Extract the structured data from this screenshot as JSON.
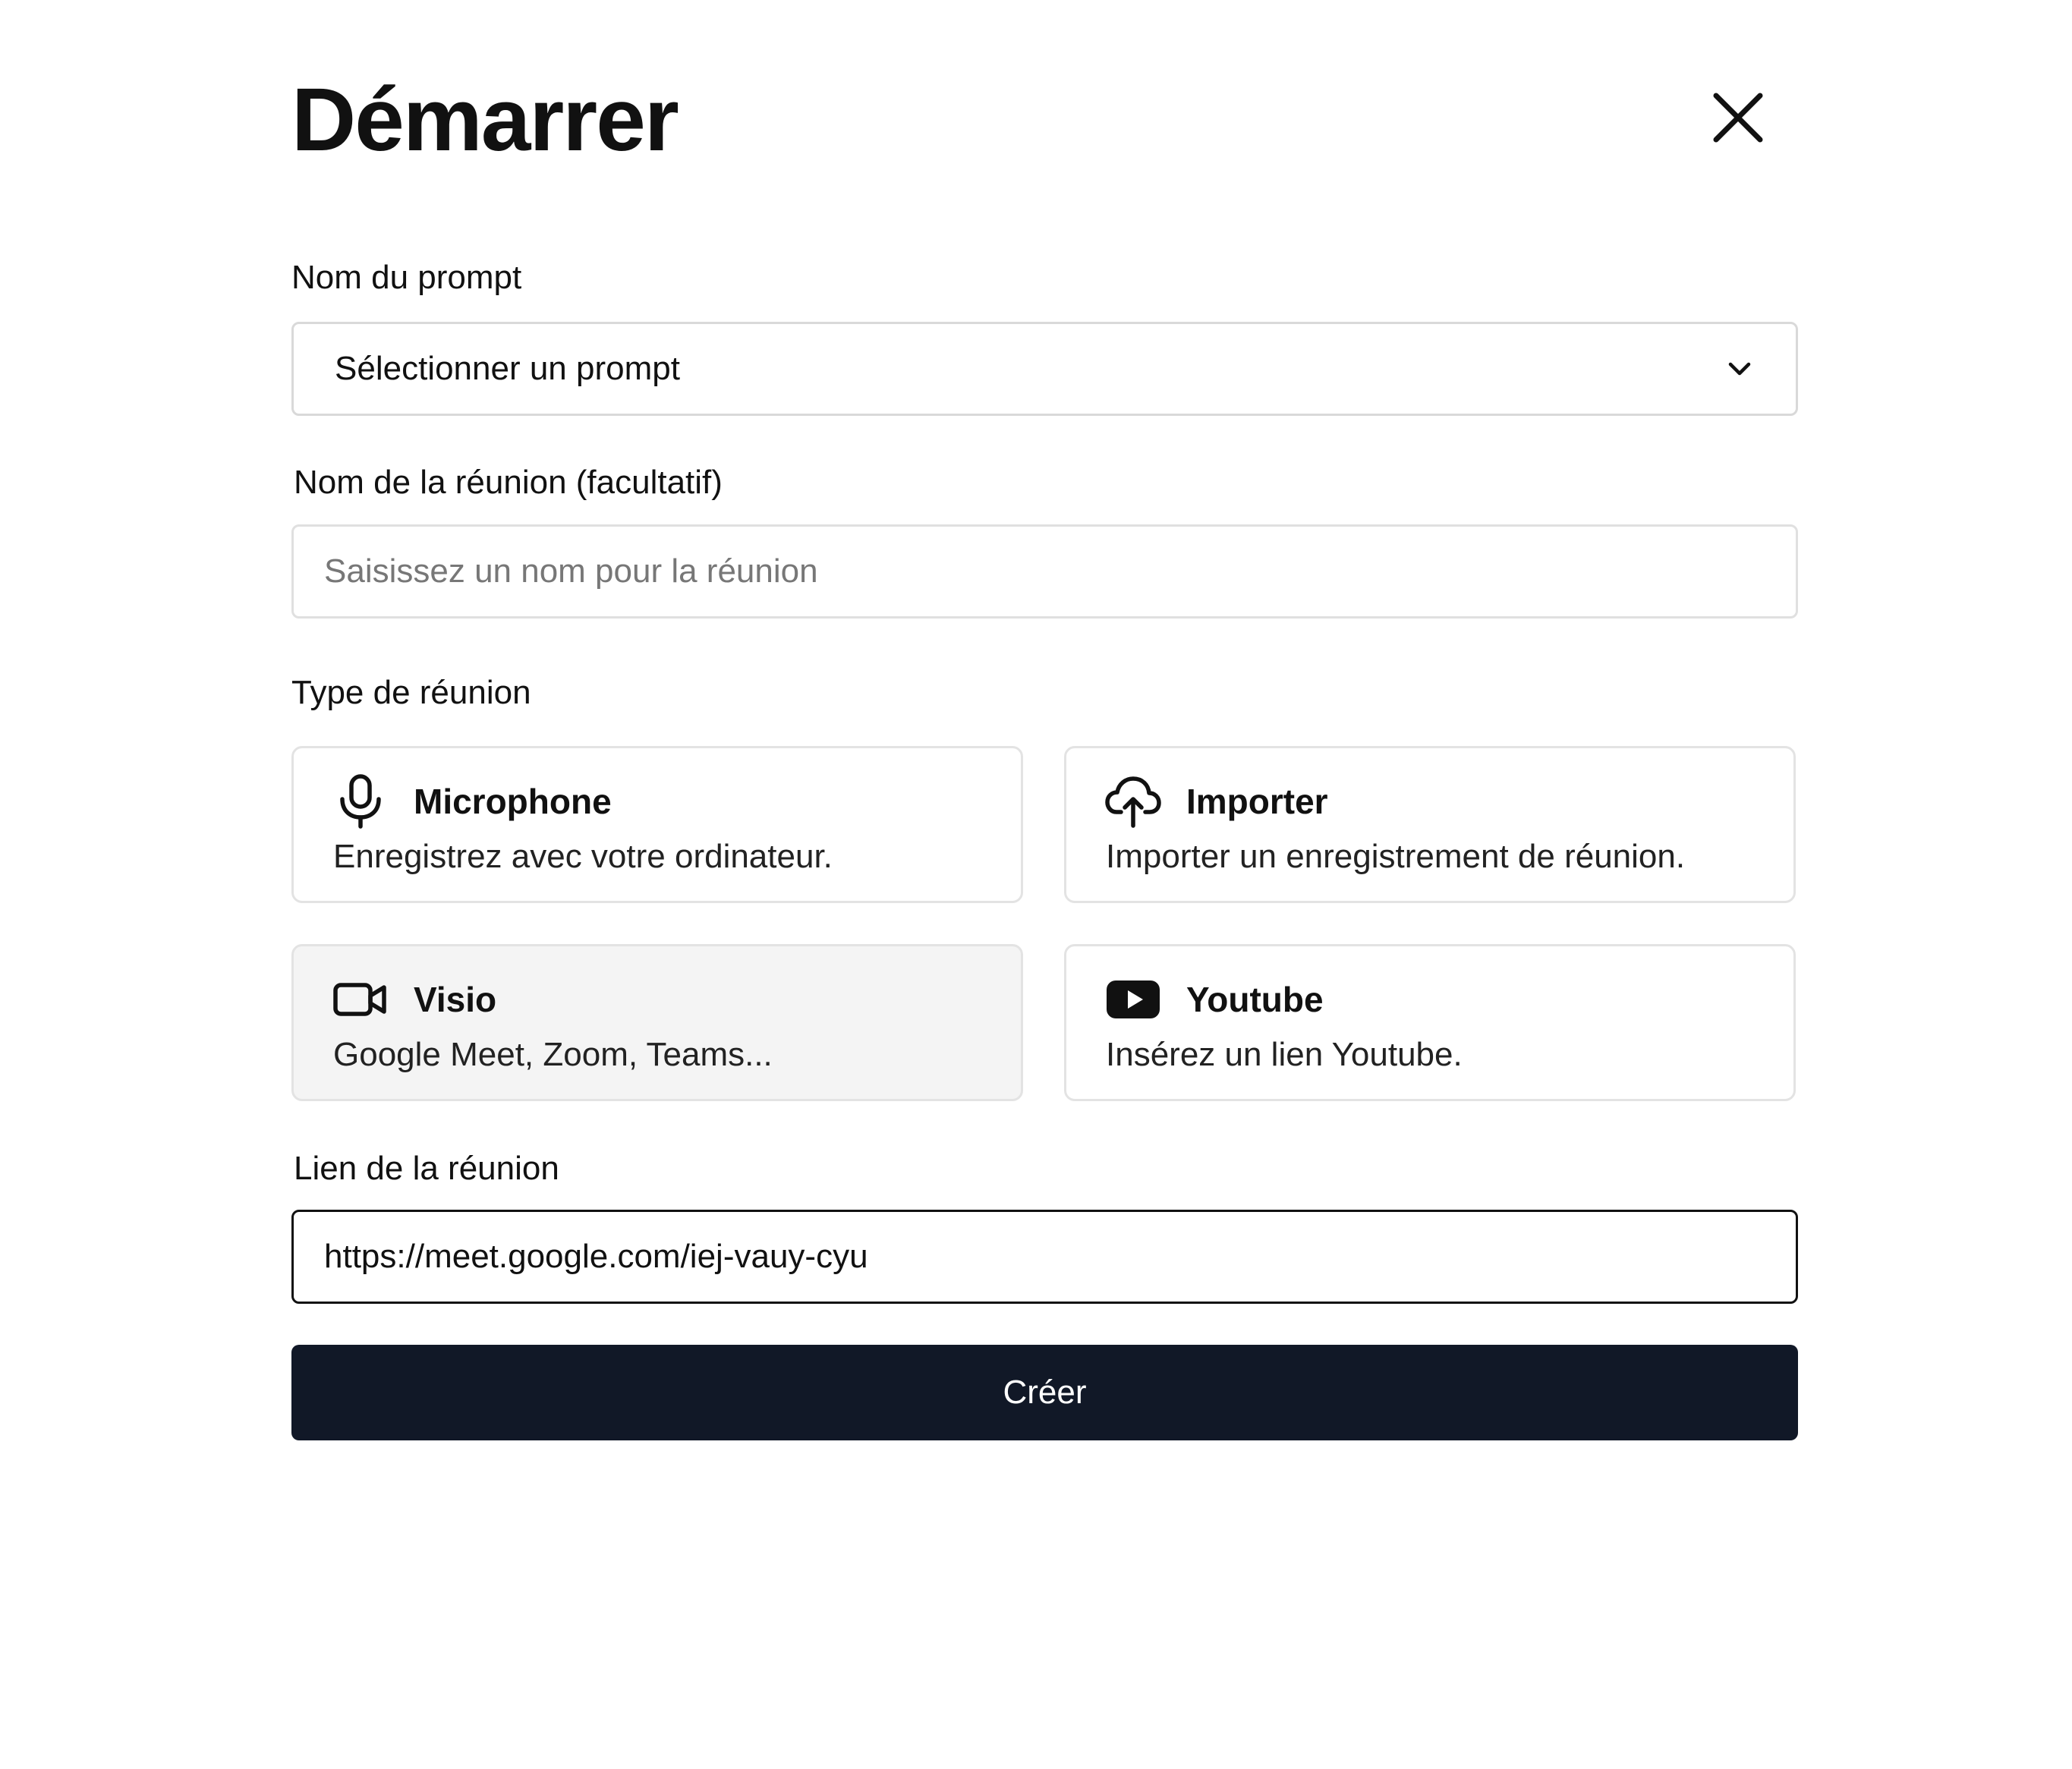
{
  "dialog": {
    "title": "Démarrer",
    "close_icon": "close-icon"
  },
  "prompt_field": {
    "label": "Nom du prompt",
    "selected_value": "Sélectionner un prompt",
    "icon": "chevron-down-icon"
  },
  "meeting_name_field": {
    "label": "Nom de la réunion (facultatif)",
    "placeholder": "Saisissez un nom pour la réunion",
    "value": ""
  },
  "meeting_type": {
    "label": "Type de réunion",
    "options": [
      {
        "title": "Microphone",
        "description": "Enregistrez avec votre ordinateur.",
        "icon": "microphone-icon",
        "selected": false
      },
      {
        "title": "Importer",
        "description": "Importer un enregistrement de réunion.",
        "icon": "cloud-upload-icon",
        "selected": false
      },
      {
        "title": "Visio",
        "description": "Google Meet, Zoom, Teams...",
        "icon": "video-camera-icon",
        "selected": true
      },
      {
        "title": "Youtube",
        "description": "Insérez un lien Youtube.",
        "icon": "youtube-icon",
        "selected": false
      }
    ]
  },
  "meeting_link_field": {
    "label": "Lien de la réunion",
    "value": "https://meet.google.com/iej-vauy-cyu"
  },
  "submit": {
    "label": "Créer"
  },
  "colors": {
    "primary_button": "#111827",
    "selected_card": "#f4f4f4",
    "border": "#e3e3e3",
    "text": "#111111"
  }
}
